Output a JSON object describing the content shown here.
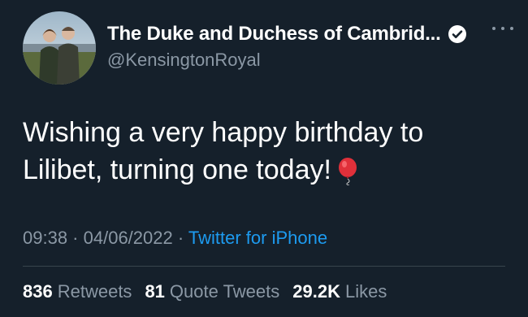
{
  "author": {
    "display_name": "The Duke and Duchess of Cambrid...",
    "handle": "@KensingtonRoyal",
    "verified": true,
    "avatar": "profile-photo-couple"
  },
  "tweet": {
    "text_line1": "Wishing a very happy birthday to",
    "text_line2": "Lilibet, turning one today!",
    "emoji": "balloon-icon"
  },
  "meta": {
    "time": "09:38",
    "separator1": " · ",
    "date": "04/06/2022",
    "separator2": " · ",
    "source": "Twitter for iPhone"
  },
  "stats": [
    {
      "value": "836",
      "label": "Retweets"
    },
    {
      "value": "81",
      "label": "Quote Tweets"
    },
    {
      "value": "29.2K",
      "label": "Likes"
    }
  ],
  "colors": {
    "background": "#15202b",
    "text_primary": "#ffffff",
    "text_secondary": "#8b98a5",
    "link": "#1d9bf0",
    "divider": "#38444d"
  }
}
